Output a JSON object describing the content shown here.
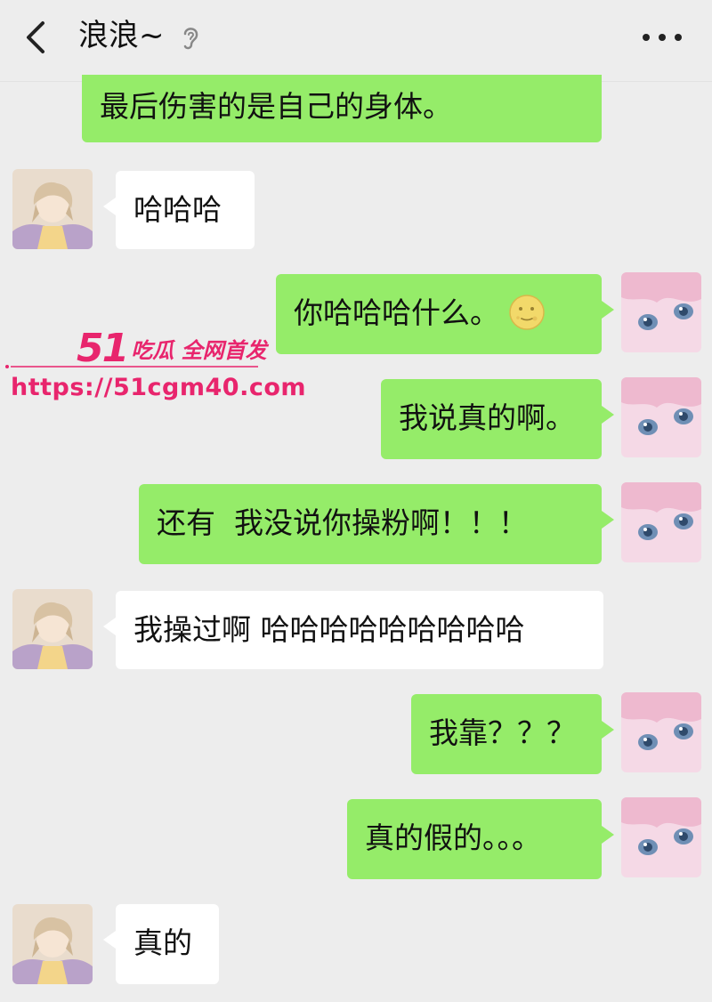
{
  "header": {
    "title": "浪浪~"
  },
  "messages": [
    {
      "side": "out",
      "text": "最后伤害的是自己的身体。"
    },
    {
      "side": "in",
      "text": "哈哈哈"
    },
    {
      "side": "out",
      "text": "你哈哈哈什么。"
    },
    {
      "side": "out",
      "text": "我说真的啊。"
    },
    {
      "side": "out",
      "text": "还有  我没说你操粉啊！！！"
    },
    {
      "side": "in",
      "text": "我操过啊 哈哈哈哈哈哈哈哈哈"
    },
    {
      "side": "out",
      "text": "我靠？？？"
    },
    {
      "side": "out",
      "text": "真的假的。。。"
    },
    {
      "side": "in",
      "text": "真的"
    }
  ],
  "watermark": {
    "number": "51",
    "tagline": "吃瓜 全网首发",
    "url": "https://51cgm40.com"
  },
  "colors": {
    "background": "#ededed",
    "outgoing_bubble": "#95ec69",
    "incoming_bubble": "#ffffff",
    "watermark": "#e8256d"
  },
  "icons": [
    "back-chevron-icon",
    "ear-icon",
    "more-icon",
    "moon-emoji-icon"
  ]
}
